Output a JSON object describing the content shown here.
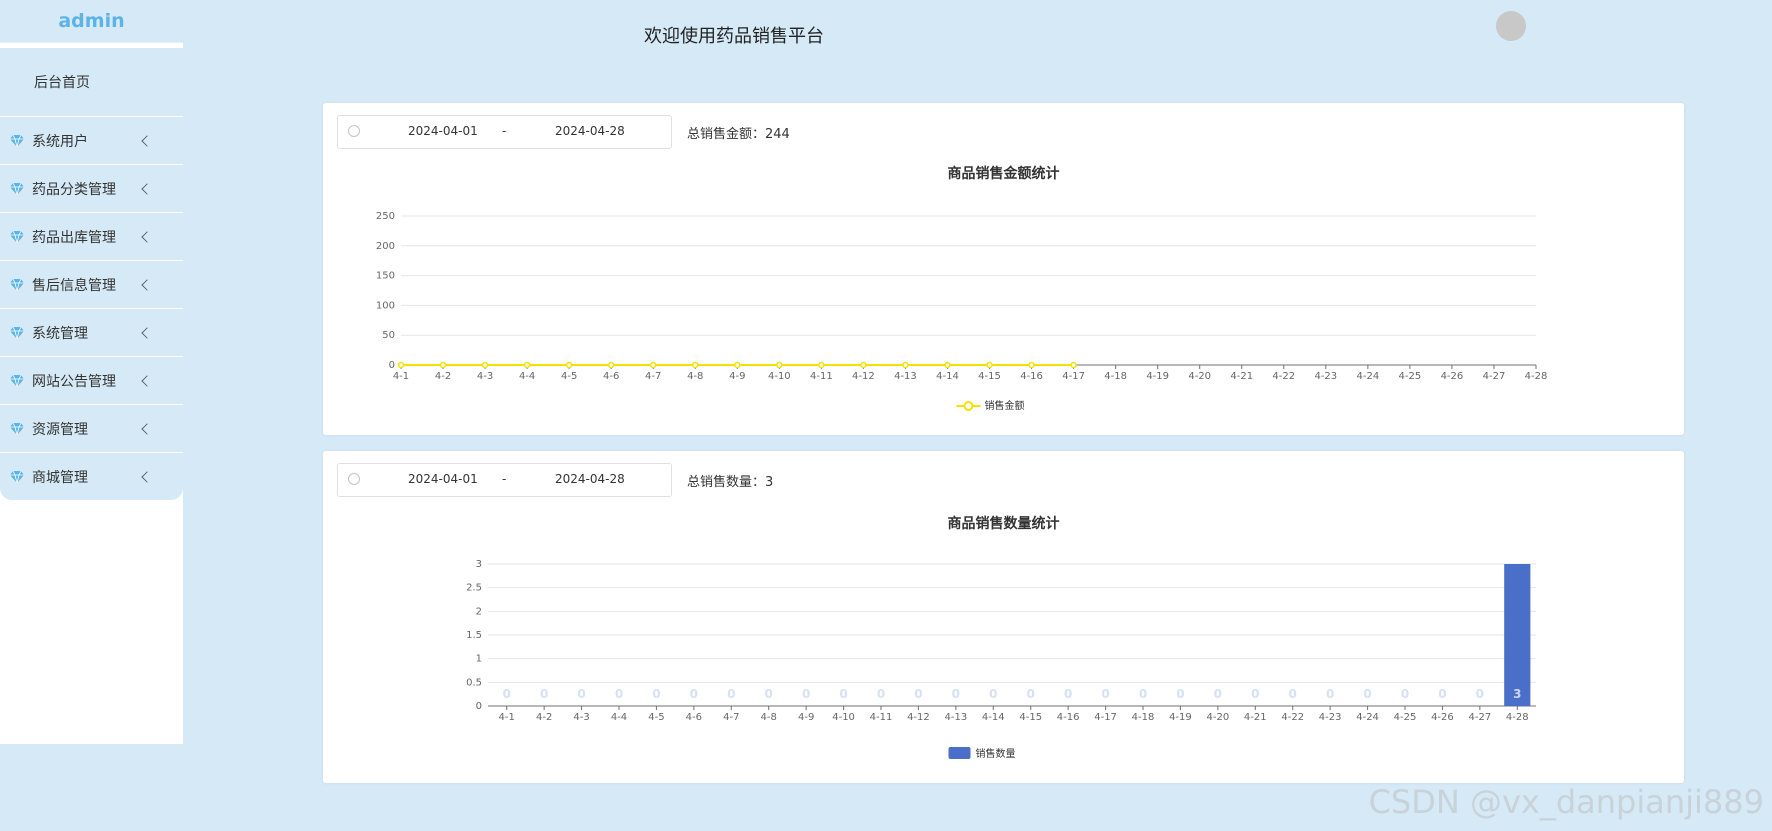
{
  "sidebar": {
    "brand": "admin",
    "home": "后台首页",
    "items": [
      {
        "label": "系统用户"
      },
      {
        "label": "药品分类管理"
      },
      {
        "label": "药品出库管理"
      },
      {
        "label": "售后信息管理"
      },
      {
        "label": "系统管理"
      },
      {
        "label": "网站公告管理"
      },
      {
        "label": "资源管理"
      },
      {
        "label": "商城管理"
      }
    ]
  },
  "header": {
    "title": "欢迎使用药品销售平台"
  },
  "amount_panel": {
    "start_date": "2024-04-01",
    "separator": "-",
    "end_date": "2024-04-28",
    "total_label": "总销售金额：",
    "total_value": "244"
  },
  "quantity_panel": {
    "start_date": "2024-04-01",
    "separator": "-",
    "end_date": "2024-04-28",
    "total_label": "总销售数量：",
    "total_value": "3"
  },
  "chart_data": [
    {
      "type": "line",
      "title": "商品销售金额统计",
      "categories": [
        "4-1",
        "4-2",
        "4-3",
        "4-4",
        "4-5",
        "4-6",
        "4-7",
        "4-8",
        "4-9",
        "4-10",
        "4-11",
        "4-12",
        "4-13",
        "4-14",
        "4-15",
        "4-16",
        "4-17",
        "4-18",
        "4-19",
        "4-20",
        "4-21",
        "4-22",
        "4-23",
        "4-24",
        "4-25",
        "4-26",
        "4-27",
        "4-28"
      ],
      "yticks": [
        "0",
        "50",
        "100",
        "150",
        "200",
        "250"
      ],
      "ylim": [
        0,
        250
      ],
      "series": [
        {
          "name": "销售金额",
          "values": [
            0,
            0,
            0,
            0,
            0,
            0,
            0,
            0,
            0,
            0,
            0,
            0,
            0,
            0,
            0,
            0,
            0
          ],
          "color": "#f5e100"
        }
      ],
      "legend": "bottom-center",
      "grid": true
    },
    {
      "type": "bar",
      "title": "商品销售数量统计",
      "categories": [
        "4-1",
        "4-2",
        "4-3",
        "4-4",
        "4-5",
        "4-6",
        "4-7",
        "4-8",
        "4-9",
        "4-10",
        "4-11",
        "4-12",
        "4-13",
        "4-14",
        "4-15",
        "4-16",
        "4-17",
        "4-18",
        "4-19",
        "4-20",
        "4-21",
        "4-22",
        "4-23",
        "4-24",
        "4-25",
        "4-26",
        "4-27",
        "4-28"
      ],
      "yticks": [
        "0",
        "0.5",
        "1",
        "1.5",
        "2",
        "2.5",
        "3"
      ],
      "ylim": [
        0,
        3
      ],
      "series": [
        {
          "name": "销售数量",
          "values": [
            0,
            0,
            0,
            0,
            0,
            0,
            0,
            0,
            0,
            0,
            0,
            0,
            0,
            0,
            0,
            0,
            0,
            0,
            0,
            0,
            0,
            0,
            0,
            0,
            0,
            0,
            0,
            3
          ],
          "color": "#4a6fc9"
        }
      ],
      "legend": "bottom-center",
      "grid": true
    }
  ],
  "watermark": "CSDN @vx_danpianji889"
}
